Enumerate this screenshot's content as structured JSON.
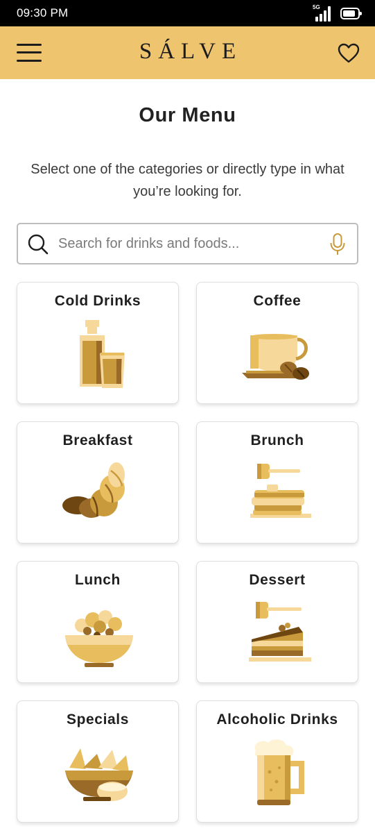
{
  "status_bar": {
    "time": "09:30 PM",
    "network": "5G"
  },
  "app_bar": {
    "logo": "SÁLVE",
    "brand_color": "#efc46e"
  },
  "page": {
    "title": "Our Menu",
    "subtitle": "Select one of the categories or directly type in what you’re looking for."
  },
  "search": {
    "placeholder": "Search for drinks and foods...",
    "value": ""
  },
  "categories": [
    {
      "label": "Cold Drinks",
      "icon": "cold-drinks-icon"
    },
    {
      "label": "Coffee",
      "icon": "coffee-icon"
    },
    {
      "label": "Breakfast",
      "icon": "croissant-icon"
    },
    {
      "label": "Brunch",
      "icon": "pancakes-icon"
    },
    {
      "label": "Lunch",
      "icon": "salad-bowl-icon"
    },
    {
      "label": "Dessert",
      "icon": "cake-slice-icon"
    },
    {
      "label": "Specials",
      "icon": "nachos-bowl-icon"
    },
    {
      "label": "Alcoholic Drinks",
      "icon": "beer-mug-icon"
    }
  ],
  "colors": {
    "gold_light": "#f6d89a",
    "gold": "#e8bd5e",
    "gold_mid": "#c99a3c",
    "brown": "#9a6a28",
    "brown_dark": "#6e4612"
  }
}
